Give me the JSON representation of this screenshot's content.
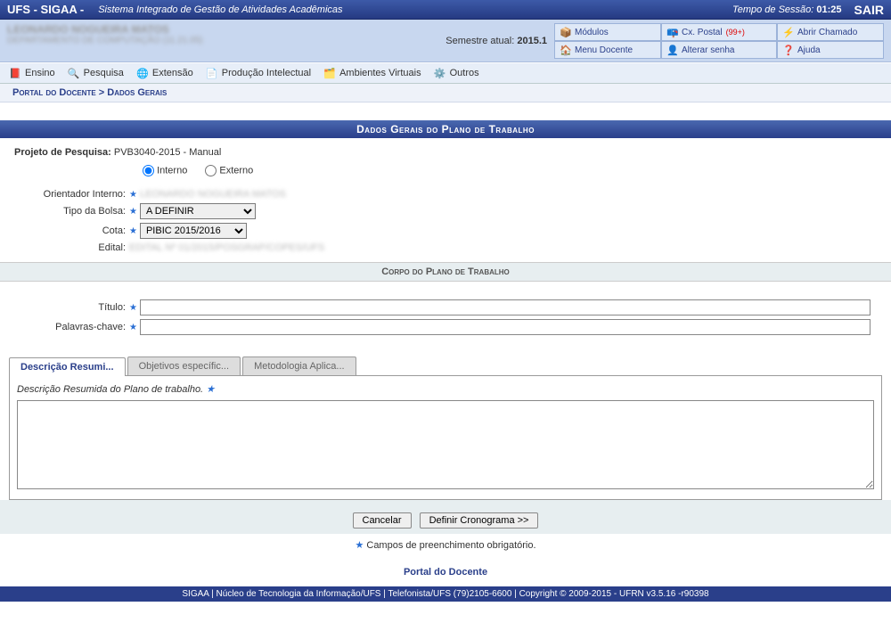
{
  "topbar": {
    "app": "UFS - SIGAA -",
    "subtitle": "Sistema Integrado de Gestão de Atividades Acadêmicas",
    "session_label": "Tempo de Sessão:",
    "session_time": "01:25",
    "logout": "SAIR"
  },
  "user": {
    "name": "LEONARDO NOGUEIRA MATOS",
    "dept": "DEPARTAMENTO DE COMPUTAÇÃO (11.21.05)",
    "semestre_label": "Semestre atual:",
    "semestre_value": "2015.1"
  },
  "shortcuts": {
    "modulos": "Módulos",
    "cx_postal": "Cx. Postal",
    "cx_postal_badge": "(99+)",
    "abrir_chamado": "Abrir Chamado",
    "menu_docente": "Menu Docente",
    "alterar_senha": "Alterar senha",
    "ajuda": "Ajuda"
  },
  "menu": {
    "ensino": "Ensino",
    "pesquisa": "Pesquisa",
    "extensao": "Extensão",
    "producao": "Produção Intelectual",
    "ambientes": "Ambientes Virtuais",
    "outros": "Outros"
  },
  "breadcrumb": {
    "root": "Portal do Docente",
    "sep": ">",
    "current": "Dados Gerais"
  },
  "section_title": "Dados Gerais do Plano de Trabalho",
  "form": {
    "projeto_label": "Projeto de Pesquisa:",
    "projeto_value": "PVB3040-2015 - Manual",
    "radio_interno": "Interno",
    "radio_externo": "Externo",
    "orientador_label": "Orientador Interno:",
    "orientador_value": "LEONARDO NOGUEIRA MATOS",
    "tipo_bolsa_label": "Tipo da Bolsa:",
    "tipo_bolsa_value": "A DEFINIR",
    "cota_label": "Cota:",
    "cota_value": "PIBIC 2015/2016",
    "edital_label": "Edital:",
    "edital_value": "EDITAL Nº 01/2015/POSGRAP/COPES/UFS"
  },
  "sub_title": "Corpo do Plano de Trabalho",
  "fields": {
    "titulo_label": "Título:",
    "palavras_label": "Palavras-chave:"
  },
  "tabs": {
    "t1": "Descrição Resumi...",
    "t2": "Objetivos específic...",
    "t3": "Metodologia Aplica...",
    "desc_label": "Descrição Resumida do Plano de trabalho."
  },
  "buttons": {
    "cancelar": "Cancelar",
    "definir": "Definir Cronograma >>"
  },
  "required_note": "Campos de preenchimento obrigatório.",
  "portal_link": "Portal do Docente",
  "footer": "SIGAA | Núcleo de Tecnologia da Informação/UFS | Telefonista/UFS (79)2105-6600 | Copyright © 2009-2015 - UFRN v3.5.16 -r90398"
}
